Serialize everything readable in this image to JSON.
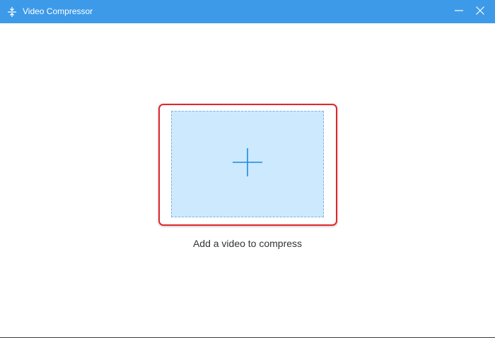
{
  "window": {
    "title": "Video Compressor",
    "icon": "compress-icon",
    "controls": [
      "minimize-icon",
      "close-icon"
    ]
  },
  "main": {
    "drop_zone_icon": "plus-icon",
    "hint": "Add a video to compress"
  },
  "colors": {
    "titlebar": "#3d9ae8",
    "drop_zone_fill": "#cde9fd",
    "drop_zone_border": "#7eb3e2",
    "highlight_border": "#e1262e",
    "plus": "#1a8be0"
  }
}
